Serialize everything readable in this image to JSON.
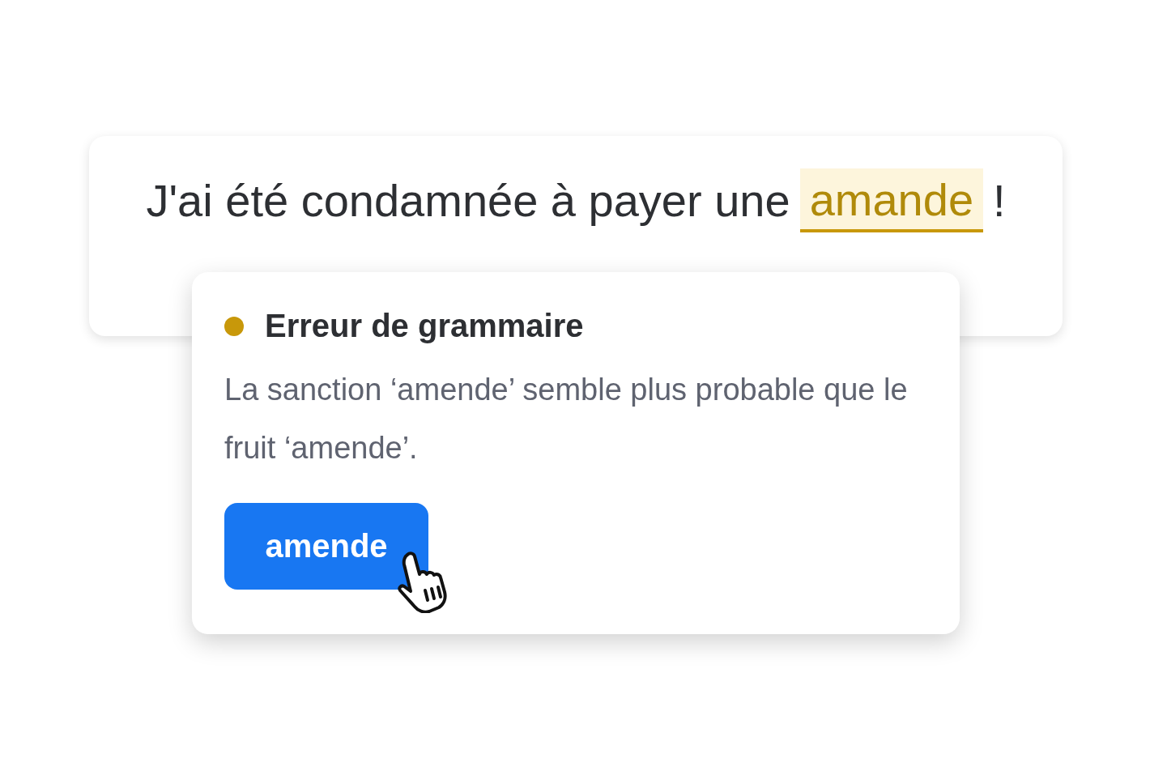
{
  "sentence": {
    "before": "J'ai été condamnée à payer une",
    "flagged": "amande",
    "after": "!"
  },
  "popup": {
    "title": "Erreur de grammaire",
    "message": "La sanction ‘amende’ semble plus probable que le fruit ‘amende’.",
    "suggestion": "amende"
  }
}
